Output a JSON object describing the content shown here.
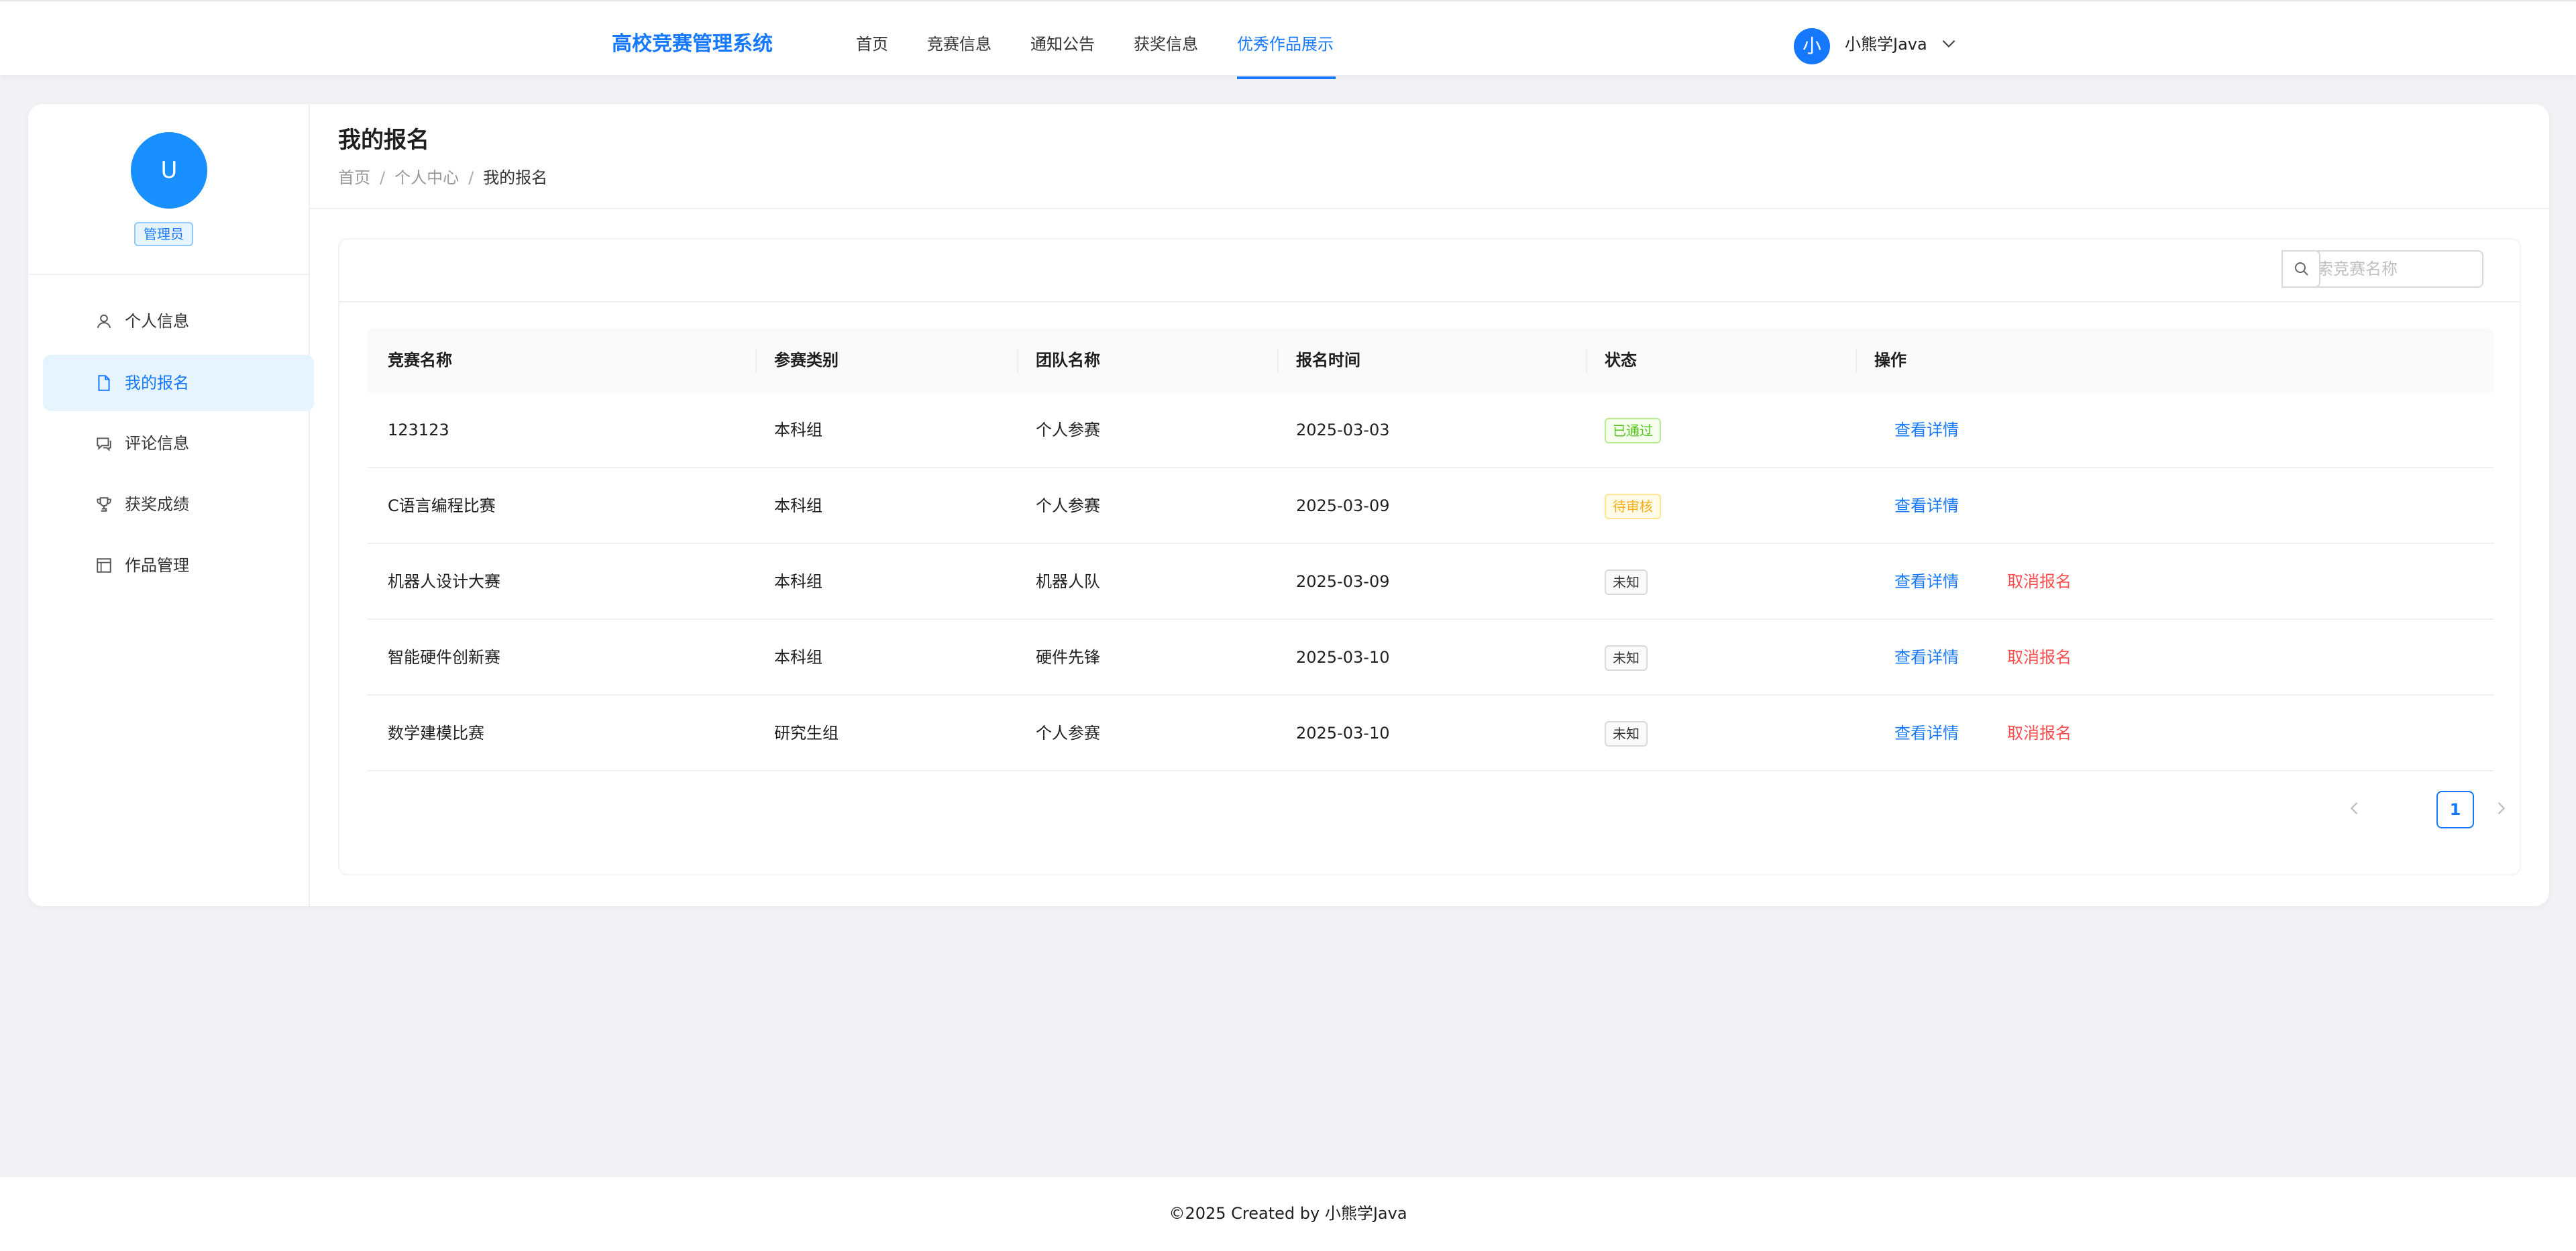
{
  "header": {
    "brand": "高校竞赛管理系统",
    "nav": [
      {
        "label": "首页",
        "active": false
      },
      {
        "label": "竞赛信息",
        "active": false
      },
      {
        "label": "通知公告",
        "active": false
      },
      {
        "label": "获奖信息",
        "active": false
      },
      {
        "label": "优秀作品展示",
        "active": true
      }
    ],
    "user": {
      "avatar_text": "小",
      "name": "小熊学Java",
      "dropdown_icon": "chevron-down-icon"
    }
  },
  "sidebar": {
    "avatar_text": "U",
    "role": "管理员",
    "menu": [
      {
        "label": "个人信息",
        "icon": "user-icon",
        "active": false
      },
      {
        "label": "我的报名",
        "icon": "file-icon",
        "active": true
      },
      {
        "label": "评论信息",
        "icon": "comment-icon",
        "active": false
      },
      {
        "label": "获奖成绩",
        "icon": "trophy-icon",
        "active": false
      },
      {
        "label": "作品管理",
        "icon": "works-icon",
        "active": false
      }
    ]
  },
  "page": {
    "title": "我的报名",
    "breadcrumb": [
      "首页",
      "个人中心",
      "我的报名"
    ]
  },
  "search": {
    "placeholder": "搜索竞赛名称",
    "value": "",
    "icon": "search-icon"
  },
  "table": {
    "columns": [
      "竞赛名称",
      "参赛类别",
      "团队名称",
      "报名时间",
      "状态",
      "操作"
    ],
    "rows": [
      {
        "name": "123123",
        "category": "本科组",
        "team": "个人参赛",
        "date": "2025-03-03",
        "status": "已通过",
        "actions": [
          "查看详情"
        ]
      },
      {
        "name": "C语言编程比赛",
        "category": "本科组",
        "team": "个人参赛",
        "date": "2025-03-09",
        "status": "待审核",
        "actions": [
          "查看详情"
        ]
      },
      {
        "name": "机器人设计大赛",
        "category": "本科组",
        "team": "机器人队",
        "date": "2025-03-09",
        "status": "未知",
        "actions": [
          "查看详情",
          "取消报名"
        ]
      },
      {
        "name": "智能硬件创新赛",
        "category": "本科组",
        "team": "硬件先锋",
        "date": "2025-03-10",
        "status": "未知",
        "actions": [
          "查看详情",
          "取消报名"
        ]
      },
      {
        "name": "数学建模比赛",
        "category": "研究生组",
        "team": "个人参赛",
        "date": "2025-03-10",
        "status": "未知",
        "actions": [
          "查看详情",
          "取消报名"
        ]
      }
    ]
  },
  "pagination": {
    "current": "1"
  },
  "footer": {
    "text": "©2025 Created by 小熊学Java"
  },
  "colors": {
    "primary": "#1677ff",
    "danger": "#ff4d4f",
    "success": "#52c41a",
    "warning": "#faad14",
    "page_bg": "#f0f2f5"
  }
}
